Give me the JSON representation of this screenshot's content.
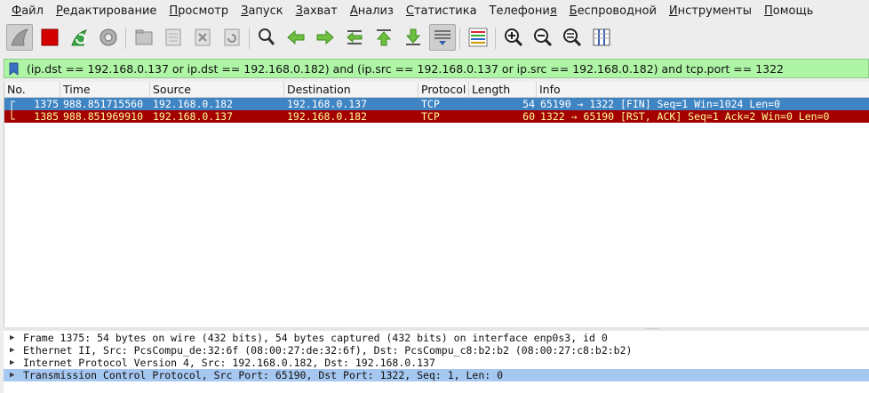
{
  "menu": {
    "items": [
      {
        "prefix": "",
        "ul": "Ф",
        "rest": "айл"
      },
      {
        "prefix": "",
        "ul": "Р",
        "rest": "едактирование"
      },
      {
        "prefix": "",
        "ul": "П",
        "rest": "росмотр"
      },
      {
        "prefix": "",
        "ul": "З",
        "rest": "апуск"
      },
      {
        "prefix": "",
        "ul": "З",
        "rest": "ахват"
      },
      {
        "prefix": "",
        "ul": "А",
        "rest": "нализ"
      },
      {
        "prefix": "",
        "ul": "С",
        "rest": "татистика"
      },
      {
        "prefix": "Телефони",
        "ul": "я",
        "rest": ""
      },
      {
        "prefix": "",
        "ul": "Б",
        "rest": "еспроводной"
      },
      {
        "prefix": "",
        "ul": "И",
        "rest": "нструменты"
      },
      {
        "prefix": "",
        "ul": "П",
        "rest": "омощь"
      }
    ]
  },
  "toolbar": {
    "icons": [
      "shark-fin-start-icon",
      "stop-capture-icon",
      "restart-capture-icon",
      "capture-options-icon",
      "open-file-icon",
      "save-file-icon",
      "close-file-icon",
      "reload-file-icon",
      "find-packet-icon",
      "go-back-icon",
      "go-forward-icon",
      "go-to-packet-icon",
      "go-first-icon",
      "go-last-icon",
      "autoscroll-icon",
      "colorize-icon",
      "zoom-in-icon",
      "zoom-out-icon",
      "zoom-normal-icon",
      "resize-columns-icon"
    ]
  },
  "filter": {
    "text": "(ip.dst == 192.168.0.137 or ip.dst == 192.168.0.182) and (ip.src == 192.168.0.137 or ip.src == 192.168.0.182) and tcp.port == 1322"
  },
  "packet_list": {
    "columns": [
      "No.",
      "Time",
      "Source",
      "Destination",
      "Protocol",
      "Length",
      "Info"
    ],
    "rows": [
      {
        "no": "1375",
        "time": "988.851715560",
        "source": "192.168.0.182",
        "destination": "192.168.0.137",
        "protocol": "TCP",
        "length": "54",
        "info": "65190 → 1322 [FIN] Seq=1 Win=1024 Len=0"
      },
      {
        "no": "1385",
        "time": "988.851969910",
        "source": "192.168.0.137",
        "destination": "192.168.0.182",
        "protocol": "TCP",
        "length": "60",
        "info": "1322 → 65190 [RST, ACK] Seq=1 Ack=2 Win=0 Len=0"
      }
    ]
  },
  "details": {
    "lines": [
      "Frame 1375: 54 bytes on wire (432 bits), 54 bytes captured (432 bits) on interface enp0s3, id 0",
      "Ethernet II, Src: PcsCompu_de:32:6f (08:00:27:de:32:6f), Dst: PcsCompu_c8:b2:b2 (08:00:27:c8:b2:b2)",
      "Internet Protocol Version 4, Src: 192.168.0.182, Dst: 192.168.0.137",
      "Transmission Control Protocol, Src Port: 65190, Dst Port: 1322, Seq: 1, Len: 0"
    ],
    "selected_index": 3
  },
  "colors": {
    "selected_row": "#3f85c3",
    "rst_row_bg": "#a40000",
    "rst_row_fg": "#fffc9c",
    "filter_bg": "#aff5a6",
    "detail_selected": "#a6c7f0"
  }
}
